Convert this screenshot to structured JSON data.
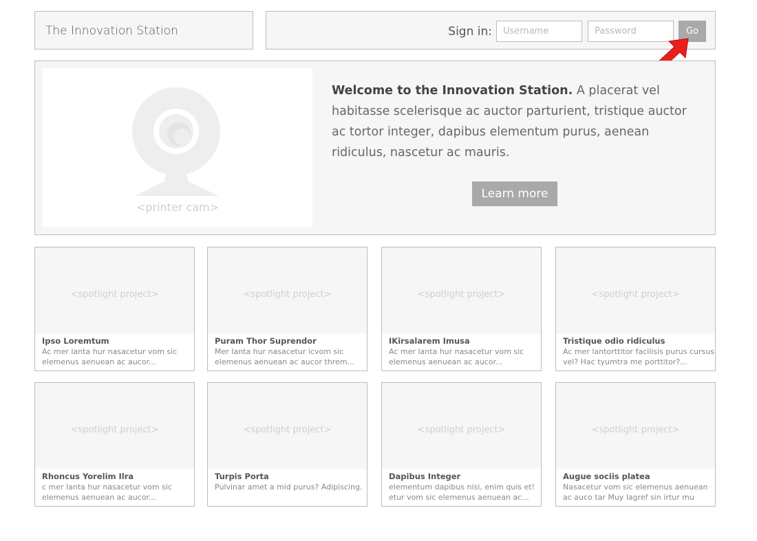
{
  "header": {
    "site_title": "The Innovation Station",
    "signin_label": "Sign in:",
    "username_placeholder": "Username",
    "password_placeholder": "Password",
    "go_label": "Go"
  },
  "hero": {
    "cam_caption": "<printer cam>",
    "headline": "Welcome to the Innovation Station.",
    "body": " A placerat vel habitasse scelerisque ac auctor parturient, tristique auctor ac tortor integer, dapibus elementum purus, aenean ridiculus, nascetur ac mauris.",
    "learn_more_label": "Learn more"
  },
  "cards": [
    {
      "thumb": "<spotlight project>",
      "title": "Ipso Loremtum",
      "desc": "Ac mer lanta hur nasacetur vom sic elemenus aenuean ac aucor..."
    },
    {
      "thumb": "<spotlight project>",
      "title": "Puram Thor Suprendor",
      "desc": "Mer lanta hur nasacetur icvom sic elemenus aenuean ac aucor threm..."
    },
    {
      "thumb": "<spotlight project>",
      "title": "IKirsalarem Imusa",
      "desc": "Ac mer lanta hur nasacetur vom sic elemenus aenuean ac aucor..."
    },
    {
      "thumb": "<spotlight project>",
      "title": "Tristique odio ridiculus",
      "desc": "Ac mer lantorttitor facilisis purus cursus vel? Hac tyumtra me porttitor?..."
    },
    {
      "thumb": "<spotlight project>",
      "title": "Rhoncus Yorelim Ilra",
      "desc": "c mer lanta hur nasacetur vom sic elemenus aenuean ac aucor..."
    },
    {
      "thumb": "<spotlight project>",
      "title": "Turpis Porta",
      "desc": "Pulvinar amet a mid purus? Adipiscing."
    },
    {
      "thumb": "<spotlight project>",
      "title": "Dapibus Integer",
      "desc": "elementum dapibus nisi, enim quis et! etur vom sic elemenus aenuean ac..."
    },
    {
      "thumb": "<spotlight project>",
      "title": "Augue sociis platea",
      "desc": "Nasacetur vom sic elemenus aenuean ac auco tar Muy lagref sin irtur mu gann..."
    }
  ],
  "colors": {
    "panel_bg": "#f5f6f5",
    "border": "#bcbcbc",
    "button_bg": "#a9a9a9",
    "arrow": "#e8201c"
  },
  "icons": {
    "cam": "webcam-icon",
    "arrow": "red-arrow-pointer"
  }
}
